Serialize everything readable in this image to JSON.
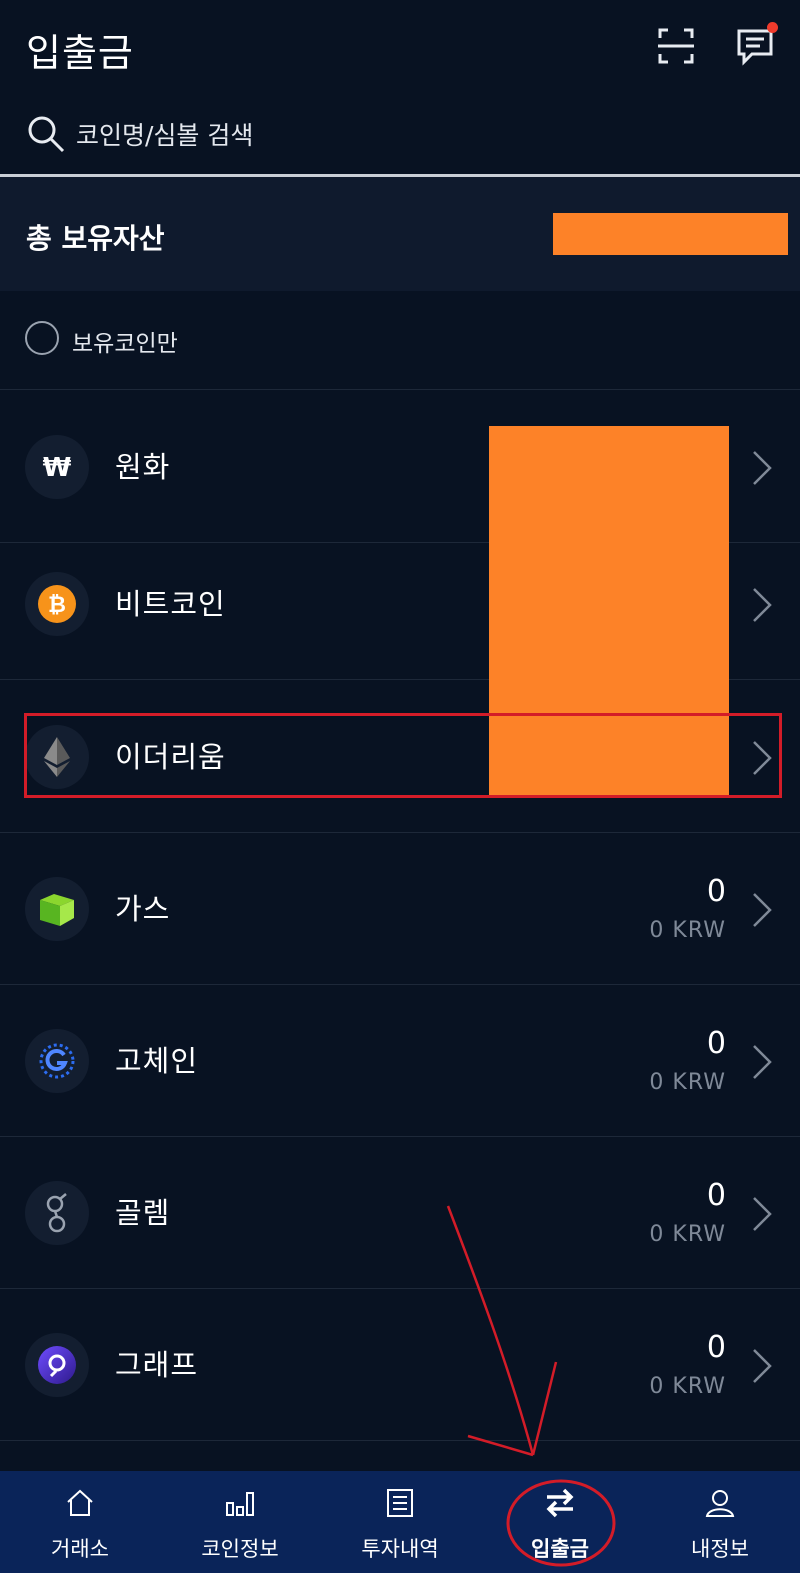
{
  "header": {
    "title": "입출금",
    "icons": [
      "scan-icon",
      "chat-icon"
    ]
  },
  "search": {
    "placeholder": "코인명/심볼 검색",
    "value": ""
  },
  "summary": {
    "total_assets_label": "총 보유자산",
    "total_assets_value": ""
  },
  "filter": {
    "label": "보유코인만",
    "checked": false
  },
  "coins": [
    {
      "name": "원화",
      "quantity": "",
      "krw_value": "",
      "icon": "won-icon"
    },
    {
      "name": "비트코인",
      "quantity": "",
      "krw_value": "",
      "icon": "bitcoin-icon"
    },
    {
      "name": "이더리움",
      "quantity": "",
      "krw_value": "",
      "icon": "ethereum-icon"
    },
    {
      "name": "가스",
      "quantity": "0",
      "krw_value": "0 KRW",
      "icon": "neo-gas-icon"
    },
    {
      "name": "고체인",
      "quantity": "0",
      "krw_value": "0 KRW",
      "icon": "gochain-icon"
    },
    {
      "name": "골렘",
      "quantity": "0",
      "krw_value": "0 KRW",
      "icon": "golem-icon"
    },
    {
      "name": "그래프",
      "quantity": "0",
      "krw_value": "0 KRW",
      "icon": "graph-icon"
    }
  ],
  "nav": {
    "active": "입출금",
    "items": [
      {
        "label": "거래소",
        "icon": "home-icon"
      },
      {
        "label": "코인정보",
        "icon": "bar-chart-icon"
      },
      {
        "label": "투자내역",
        "icon": "document-icon"
      },
      {
        "label": "입출금",
        "icon": "transfer-arrows-icon"
      },
      {
        "label": "내정보",
        "icon": "person-icon"
      }
    ]
  },
  "colors": {
    "background": "#081222",
    "total_bar": "#0f1a2d",
    "nav_background": "#0a2459",
    "redaction": "#fd8228",
    "annotation": "#d31c28",
    "notification_dot": "#ef3b2c",
    "secondary_text": "#7f8998"
  }
}
